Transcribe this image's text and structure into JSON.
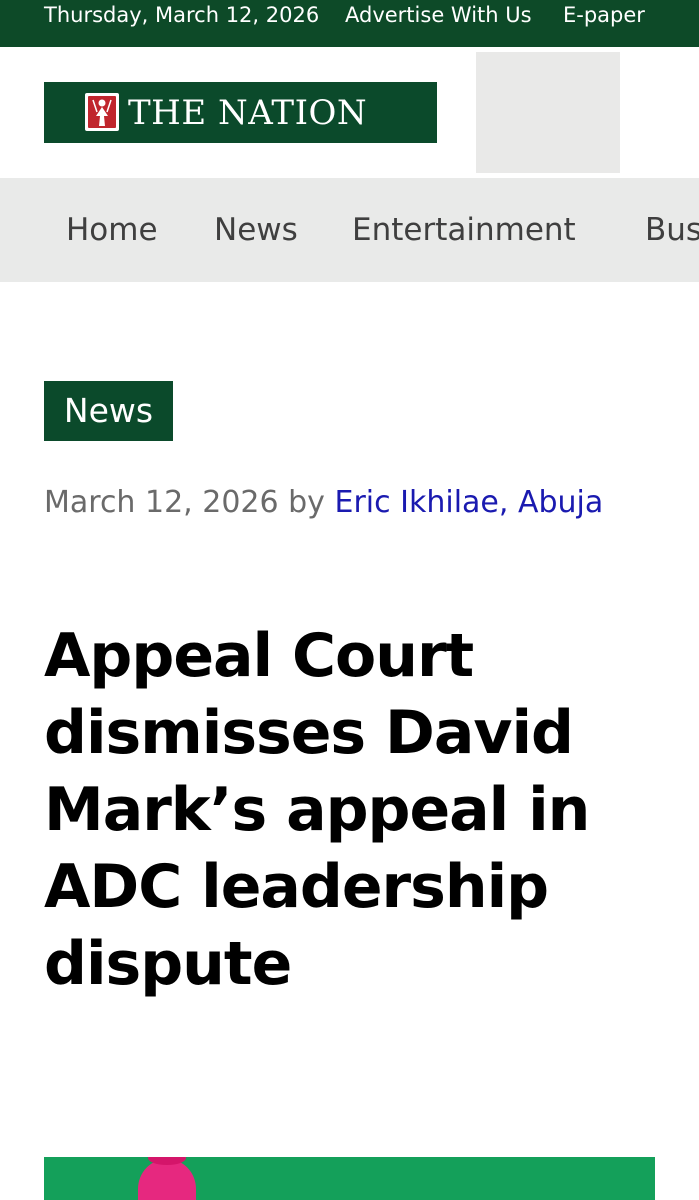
{
  "topbar": {
    "date": "Thursday, March 12, 2026",
    "advertise": "Advertise With Us",
    "epaper": "E-paper"
  },
  "header": {
    "logo_text": "THE NATION",
    "logo_icon": "nation-emblem-icon"
  },
  "nav": {
    "items": [
      {
        "label": "Home"
      },
      {
        "label": "News"
      },
      {
        "label": "Entertainment"
      },
      {
        "label": "Bus"
      }
    ]
  },
  "article": {
    "category": "News",
    "date": "March 12, 2026",
    "by": "by",
    "author": "Eric Ikhilae, Abuja",
    "headline": "Appeal Court dismisses David Mark’s appeal in ADC leadership dispute"
  },
  "colors": {
    "brand_green": "#0b4a2b",
    "nav_bg": "#e9eae9",
    "author_link": "#1a1ab0",
    "hero_bg": "#14a05a"
  }
}
